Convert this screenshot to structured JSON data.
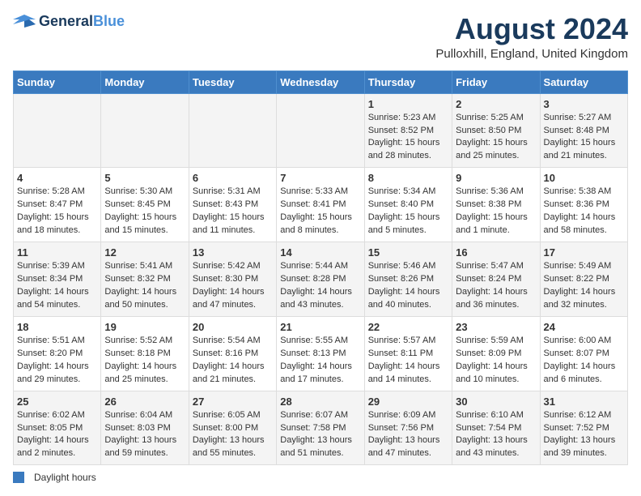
{
  "header": {
    "logo_line1": "General",
    "logo_line2": "Blue",
    "title": "August 2024",
    "subtitle": "Pulloxhill, England, United Kingdom"
  },
  "days_of_week": [
    "Sunday",
    "Monday",
    "Tuesday",
    "Wednesday",
    "Thursday",
    "Friday",
    "Saturday"
  ],
  "footer": {
    "daylight_label": "Daylight hours"
  },
  "weeks": [
    {
      "days": [
        {
          "num": "",
          "info": ""
        },
        {
          "num": "",
          "info": ""
        },
        {
          "num": "",
          "info": ""
        },
        {
          "num": "",
          "info": ""
        },
        {
          "num": "1",
          "info": "Sunrise: 5:23 AM\nSunset: 8:52 PM\nDaylight: 15 hours\nand 28 minutes."
        },
        {
          "num": "2",
          "info": "Sunrise: 5:25 AM\nSunset: 8:50 PM\nDaylight: 15 hours\nand 25 minutes."
        },
        {
          "num": "3",
          "info": "Sunrise: 5:27 AM\nSunset: 8:48 PM\nDaylight: 15 hours\nand 21 minutes."
        }
      ]
    },
    {
      "days": [
        {
          "num": "4",
          "info": "Sunrise: 5:28 AM\nSunset: 8:47 PM\nDaylight: 15 hours\nand 18 minutes."
        },
        {
          "num": "5",
          "info": "Sunrise: 5:30 AM\nSunset: 8:45 PM\nDaylight: 15 hours\nand 15 minutes."
        },
        {
          "num": "6",
          "info": "Sunrise: 5:31 AM\nSunset: 8:43 PM\nDaylight: 15 hours\nand 11 minutes."
        },
        {
          "num": "7",
          "info": "Sunrise: 5:33 AM\nSunset: 8:41 PM\nDaylight: 15 hours\nand 8 minutes."
        },
        {
          "num": "8",
          "info": "Sunrise: 5:34 AM\nSunset: 8:40 PM\nDaylight: 15 hours\nand 5 minutes."
        },
        {
          "num": "9",
          "info": "Sunrise: 5:36 AM\nSunset: 8:38 PM\nDaylight: 15 hours\nand 1 minute."
        },
        {
          "num": "10",
          "info": "Sunrise: 5:38 AM\nSunset: 8:36 PM\nDaylight: 14 hours\nand 58 minutes."
        }
      ]
    },
    {
      "days": [
        {
          "num": "11",
          "info": "Sunrise: 5:39 AM\nSunset: 8:34 PM\nDaylight: 14 hours\nand 54 minutes."
        },
        {
          "num": "12",
          "info": "Sunrise: 5:41 AM\nSunset: 8:32 PM\nDaylight: 14 hours\nand 50 minutes."
        },
        {
          "num": "13",
          "info": "Sunrise: 5:42 AM\nSunset: 8:30 PM\nDaylight: 14 hours\nand 47 minutes."
        },
        {
          "num": "14",
          "info": "Sunrise: 5:44 AM\nSunset: 8:28 PM\nDaylight: 14 hours\nand 43 minutes."
        },
        {
          "num": "15",
          "info": "Sunrise: 5:46 AM\nSunset: 8:26 PM\nDaylight: 14 hours\nand 40 minutes."
        },
        {
          "num": "16",
          "info": "Sunrise: 5:47 AM\nSunset: 8:24 PM\nDaylight: 14 hours\nand 36 minutes."
        },
        {
          "num": "17",
          "info": "Sunrise: 5:49 AM\nSunset: 8:22 PM\nDaylight: 14 hours\nand 32 minutes."
        }
      ]
    },
    {
      "days": [
        {
          "num": "18",
          "info": "Sunrise: 5:51 AM\nSunset: 8:20 PM\nDaylight: 14 hours\nand 29 minutes."
        },
        {
          "num": "19",
          "info": "Sunrise: 5:52 AM\nSunset: 8:18 PM\nDaylight: 14 hours\nand 25 minutes."
        },
        {
          "num": "20",
          "info": "Sunrise: 5:54 AM\nSunset: 8:16 PM\nDaylight: 14 hours\nand 21 minutes."
        },
        {
          "num": "21",
          "info": "Sunrise: 5:55 AM\nSunset: 8:13 PM\nDaylight: 14 hours\nand 17 minutes."
        },
        {
          "num": "22",
          "info": "Sunrise: 5:57 AM\nSunset: 8:11 PM\nDaylight: 14 hours\nand 14 minutes."
        },
        {
          "num": "23",
          "info": "Sunrise: 5:59 AM\nSunset: 8:09 PM\nDaylight: 14 hours\nand 10 minutes."
        },
        {
          "num": "24",
          "info": "Sunrise: 6:00 AM\nSunset: 8:07 PM\nDaylight: 14 hours\nand 6 minutes."
        }
      ]
    },
    {
      "days": [
        {
          "num": "25",
          "info": "Sunrise: 6:02 AM\nSunset: 8:05 PM\nDaylight: 14 hours\nand 2 minutes."
        },
        {
          "num": "26",
          "info": "Sunrise: 6:04 AM\nSunset: 8:03 PM\nDaylight: 13 hours\nand 59 minutes."
        },
        {
          "num": "27",
          "info": "Sunrise: 6:05 AM\nSunset: 8:00 PM\nDaylight: 13 hours\nand 55 minutes."
        },
        {
          "num": "28",
          "info": "Sunrise: 6:07 AM\nSunset: 7:58 PM\nDaylight: 13 hours\nand 51 minutes."
        },
        {
          "num": "29",
          "info": "Sunrise: 6:09 AM\nSunset: 7:56 PM\nDaylight: 13 hours\nand 47 minutes."
        },
        {
          "num": "30",
          "info": "Sunrise: 6:10 AM\nSunset: 7:54 PM\nDaylight: 13 hours\nand 43 minutes."
        },
        {
          "num": "31",
          "info": "Sunrise: 6:12 AM\nSunset: 7:52 PM\nDaylight: 13 hours\nand 39 minutes."
        }
      ]
    }
  ]
}
